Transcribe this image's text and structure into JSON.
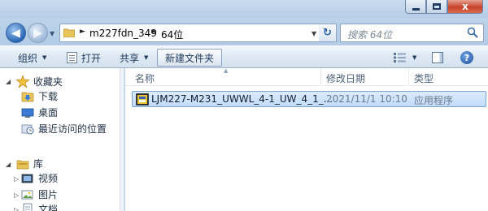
{
  "window": {
    "controls": {
      "close_glyph": "x"
    }
  },
  "nav": {
    "back_icon": "back-arrow-icon",
    "forward_icon": "forward-arrow-icon"
  },
  "address": {
    "crumbs": [
      "m227fdn_349",
      "64位"
    ],
    "refresh_glyph": "↻"
  },
  "search": {
    "placeholder": "搜索 64位"
  },
  "toolbar": {
    "organize": "组织",
    "open": "打开",
    "share": "共享",
    "new_folder": "新建文件夹",
    "help_glyph": "?"
  },
  "sidebar": {
    "favorites": "收藏夹",
    "downloads": "下载",
    "desktop": "桌面",
    "recent": "最近访问的位置",
    "libraries": "库",
    "videos": "视频",
    "pictures": "图片",
    "documents": "文档"
  },
  "columns": {
    "name": "名称",
    "modified": "修改日期",
    "type": "类型"
  },
  "files": [
    {
      "name": "LJM227-M231_UWWL_4-1_UW_4_1_...",
      "modified": "2021/11/1 10:10",
      "type": "应用程序",
      "selected": true
    }
  ],
  "colors": {
    "accent": "#1e395b",
    "selection": "#c1dcfc",
    "frame": "#bcd3ea"
  }
}
